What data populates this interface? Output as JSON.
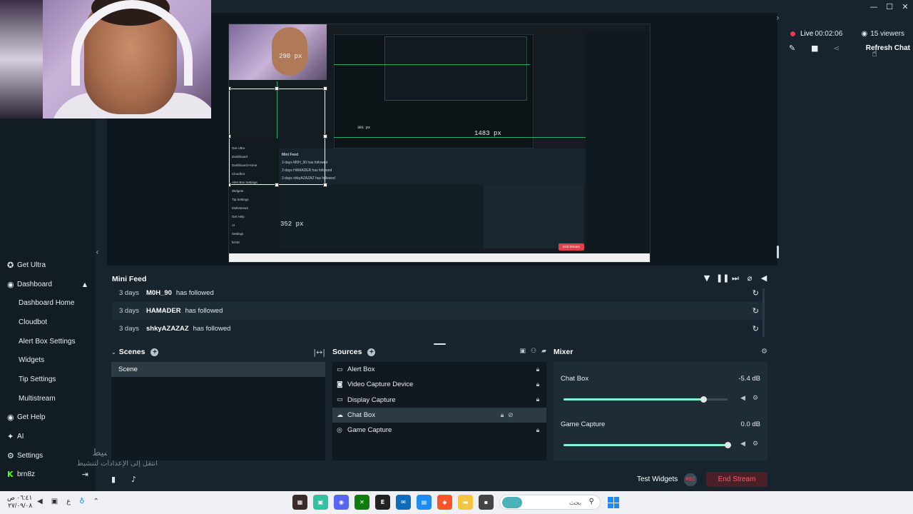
{
  "window": {
    "controls": {
      "minimize": "—",
      "maximize": "☐",
      "close": "✕"
    }
  },
  "sidebar": {
    "items": [
      {
        "label": "Get Ultra",
        "icon": "ultra-icon"
      },
      {
        "label": "Dashboard",
        "icon": "dashboard-icon"
      },
      {
        "label": "Dashboard Home"
      },
      {
        "label": "Cloudbot"
      },
      {
        "label": "Alert Box Settings"
      },
      {
        "label": "Widgets"
      },
      {
        "label": "Tip Settings"
      },
      {
        "label": "Multistream"
      },
      {
        "label": "Get Help",
        "icon": "help-icon"
      },
      {
        "label": "AI",
        "icon": "ai-icon"
      },
      {
        "label": "Settings",
        "icon": "settings-icon"
      }
    ],
    "user": {
      "name": "brn8z",
      "platform": "kick"
    }
  },
  "watermark": {
    "line1": "تنشيط Windows",
    "line2": "انتقل إلى الإعدادات لتنشيط Windows."
  },
  "preview": {
    "labels": {
      "px_top": "290 px",
      "px_right": "1483 px",
      "px_bottom": "352 px",
      "px_mid": "301 px"
    },
    "mini_feed_title": "Mini Feed",
    "mini_rows": [
      "3 days  M0H_90  has followed",
      "3 days  HAMADER  has followed",
      "3 days  shkyAZAZAZ  has followed"
    ],
    "sidebar_items": [
      "Get Ultra",
      "Dashboard",
      "Dashboard Home",
      "Cloudbot",
      "Alert Box Settings",
      "Widgets",
      "Tip Settings",
      "Multistream",
      "Get Help",
      "AI",
      "Settings",
      "brn8z"
    ],
    "end_stream": "End Stream",
    "test_widgets": "Test Widgets"
  },
  "chat": {
    "live_label": "Live",
    "live_time": "00:02:06",
    "viewers": "15 viewers",
    "refresh_label": "Refresh Chat"
  },
  "minifeed": {
    "title": "Mini Feed",
    "rows": [
      {
        "age": "3 days",
        "name": "M0H_90",
        "action": "has followed"
      },
      {
        "age": "3 days",
        "name": "HAMADER",
        "action": "has followed"
      },
      {
        "age": "3 days",
        "name": "shkyAZAZAZ",
        "action": "has followed"
      }
    ]
  },
  "scenes": {
    "title": "Scenes",
    "items": [
      "Scene"
    ]
  },
  "sources": {
    "title": "Sources",
    "items": [
      {
        "label": "Alert Box",
        "icon": "alert-box-icon"
      },
      {
        "label": "Video Capture Device",
        "icon": "camera-icon"
      },
      {
        "label": "Display Capture",
        "icon": "monitor-icon"
      },
      {
        "label": "Chat Box",
        "icon": "chat-icon",
        "selected": true
      },
      {
        "label": "Game Capture",
        "icon": "gamepad-icon"
      }
    ]
  },
  "mixer": {
    "title": "Mixer",
    "channels": [
      {
        "name": "Chat Box",
        "db": "-5.4 dB",
        "level": 0.85
      },
      {
        "name": "Game Capture",
        "db": "0.0 dB",
        "level": 1.0
      }
    ]
  },
  "footer": {
    "test_widgets": "Test Widgets",
    "rec_label": "REC",
    "end_stream": "End Stream"
  },
  "taskbar": {
    "time": "٠٦:٤١ ص",
    "date": "٢٧/٠٩/٠٨",
    "lang": "ع",
    "search_placeholder": "بحث",
    "accent": "#1d8bf1"
  },
  "colors": {
    "accent_green": "#80f5d2",
    "live_red": "#e23e4c",
    "kick_green": "#53fc18",
    "panel_bg": "#17242d"
  }
}
